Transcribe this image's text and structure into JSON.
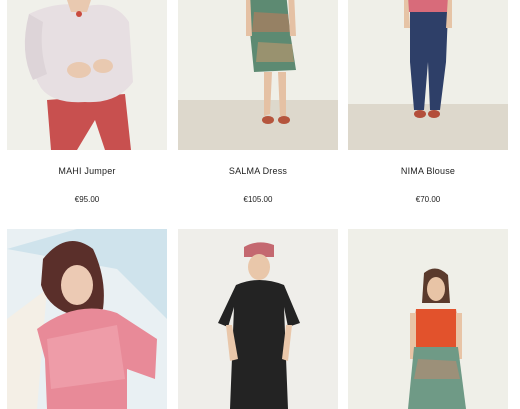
{
  "products": [
    {
      "name": "MAHI Jumper",
      "price": "€95.00"
    },
    {
      "name": "SALMA Dress",
      "price": "€105.00"
    },
    {
      "name": "NIMA Blouse",
      "price": "€70.00"
    }
  ],
  "colors": {
    "photo_bg": "#efefe9",
    "floor": "#ddd8cc"
  }
}
